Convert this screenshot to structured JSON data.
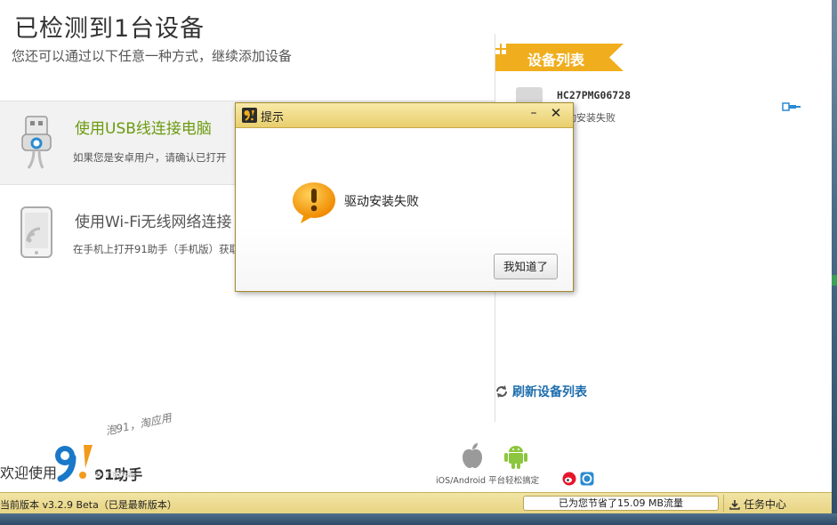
{
  "header": {
    "title": "已检测到1台设备",
    "subtitle": "您还可以通过以下任意一种方式，继续添加设备"
  },
  "options": {
    "usb": {
      "title": "使用USB线连接电脑",
      "desc": "如果您是安卓用户，请确认已打开"
    },
    "wifi": {
      "title": "使用Wi-Fi无线网络连接",
      "desc": "在手机上打开91助手（手机版）获取"
    }
  },
  "device_panel": {
    "title": "设备列表",
    "devices": [
      {
        "name": "HC27PMG06728",
        "status": "驱动安装失败"
      }
    ],
    "refresh_label": "刷新设备列表"
  },
  "branding": {
    "welcome": "欢迎使用",
    "brand": "91助手",
    "slogan": "泡91，淘应用"
  },
  "platforms": {
    "label": "iOS/Android 平台轻松搞定"
  },
  "status_bar": {
    "version": "当前版本 v3.2.9 Beta（已是最新版本）",
    "traffic": "已为您节省了15.09 MB流量",
    "task_center": "任务中心"
  },
  "dialog": {
    "title": "提示",
    "minimize": "–",
    "close": "✕",
    "message": "驱动安装失败",
    "ok_label": "我知道了"
  },
  "colors": {
    "accent_green": "#6b9b0f",
    "header_orange": "#f0ae1e",
    "link_blue": "#1e6fae",
    "status_bar": "#e8d481"
  }
}
